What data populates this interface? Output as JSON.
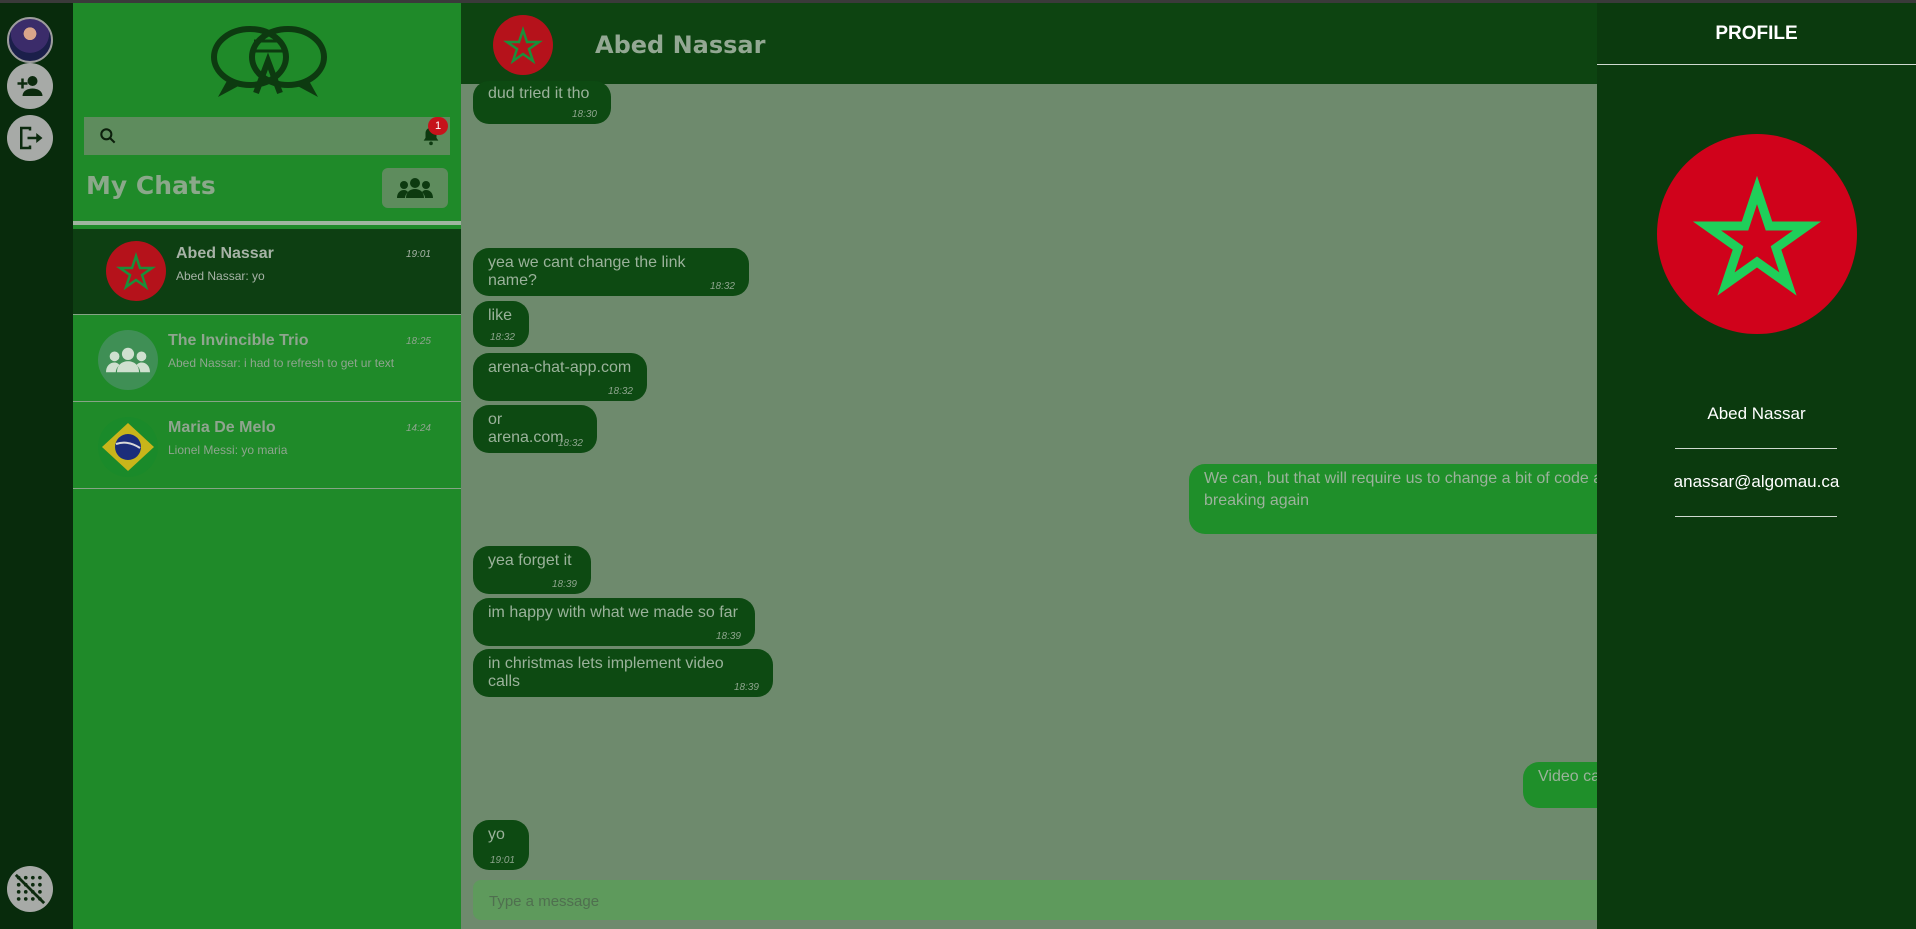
{
  "sidebar": {
    "search": {
      "placeholder": "",
      "value": ""
    },
    "notifications": {
      "count": "1"
    },
    "title": "My Chats",
    "chats": [
      {
        "name": "Abed Nassar",
        "last_message": "Abed Nassar: yo",
        "time": "19:01",
        "avatar": "morocco-flag",
        "active": true
      },
      {
        "name": "The Invincible Trio",
        "last_message": "Abed Nassar: i had to refresh to get ur text",
        "time": "18:25",
        "avatar": "group-icon",
        "active": false
      },
      {
        "name": "Maria De Melo",
        "last_message": "Lionel Messi: yo maria",
        "time": "14:24",
        "avatar": "brazil-flag",
        "active": false
      }
    ]
  },
  "chat": {
    "contact_name": "Abed Nassar",
    "messages": [
      {
        "text": "dud tried it tho",
        "time": "18:30",
        "direction": "in"
      },
      {
        "text": "yea we cant change the link name?",
        "time": "18:32",
        "direction": "in"
      },
      {
        "text": "like",
        "time": "18:32",
        "direction": "in"
      },
      {
        "text": "arena-chat-app.com",
        "time": "18:32",
        "direction": "in"
      },
      {
        "text": "or arena.com",
        "time": "18:32",
        "direction": "in"
      },
      {
        "text": "We can, but that will require us to change a bit of code a",
        "text2": "breaking again",
        "time": "",
        "direction": "out"
      },
      {
        "text": "yea forget it",
        "time": "18:39",
        "direction": "in"
      },
      {
        "text": "im happy with what we made so far",
        "time": "18:39",
        "direction": "in"
      },
      {
        "text": "in christmas lets implement video calls",
        "time": "18:39",
        "direction": "in"
      },
      {
        "text": "Video ca",
        "time": "",
        "direction": "out"
      },
      {
        "text": "yo",
        "time": "19:01",
        "direction": "in"
      }
    ],
    "input_placeholder": "Type a message"
  },
  "profile": {
    "title": "PROFILE",
    "name": "Abed Nassar",
    "email": "anassar@algomau.ca"
  },
  "colors": {
    "sidebar_bg": "#1f8a29",
    "chat_bg": "#6e8a6d",
    "profile_bg": "#0b3a0e",
    "incoming_bubble": "#0d4a12",
    "outgoing_bubble": "#1f8f2a",
    "morocco_red": "#d0021b",
    "morocco_star": "#1fcf5a",
    "badge_red": "#c6131b"
  }
}
